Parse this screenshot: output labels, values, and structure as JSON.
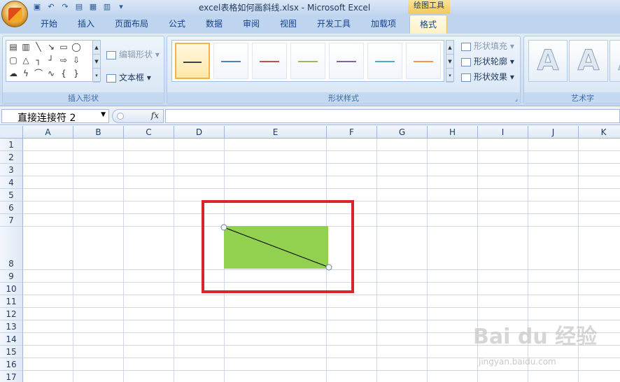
{
  "window": {
    "title": "excel表格如何画斜线.xlsx - Microsoft Excel",
    "context_tab_group": "绘图工具"
  },
  "tabs": [
    "开始",
    "插入",
    "页面布局",
    "公式",
    "数据",
    "审阅",
    "视图",
    "开发工具",
    "加载项",
    "格式"
  ],
  "active_tab": "格式",
  "ribbon": {
    "insert_shapes": {
      "label": "插入形状",
      "edit_shape": "编辑形状",
      "text_box": "文本框"
    },
    "shape_styles": {
      "label": "形状样式",
      "fill": "形状填充",
      "outline": "形状轮廓",
      "effects": "形状效果",
      "style_colors": [
        "#3f3f3f",
        "#4f81bd",
        "#c0504d",
        "#9bbb59",
        "#8064a2",
        "#4bacc6",
        "#f79646"
      ]
    },
    "wordart": {
      "label": "艺术字",
      "glyph": "A"
    }
  },
  "formula_bar": {
    "name_box": "直接连接符 2",
    "fx_label": "fx",
    "formula": ""
  },
  "columns": [
    "A",
    "B",
    "C",
    "D",
    "E",
    "F",
    "G",
    "H",
    "I",
    "J",
    "K"
  ],
  "rows": [
    "1",
    "2",
    "3",
    "4",
    "5",
    "6",
    "7",
    "8",
    "9",
    "10",
    "11",
    "12",
    "13",
    "14",
    "15",
    "16",
    "17"
  ],
  "shape": {
    "fill_color": "#92d050",
    "highlight_color": "#d6262b"
  },
  "watermark": {
    "brand": "Bai du 经验",
    "url": "jingyan.baidu.com"
  }
}
